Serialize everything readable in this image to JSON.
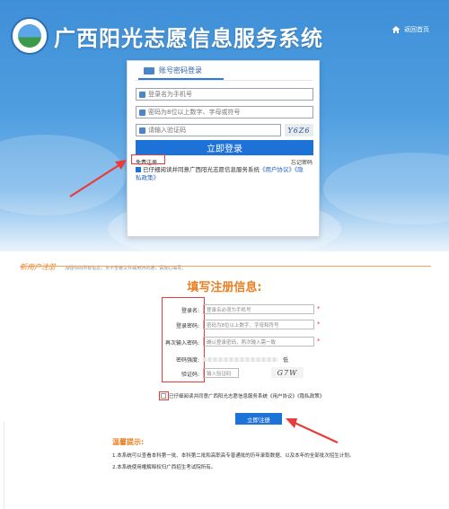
{
  "header": {
    "site_title": "广西阳光志愿信息服务系统",
    "home_link": "返回首页"
  },
  "login": {
    "tab_label": "账号密码登录",
    "username_placeholder": "登录名为手机号",
    "password_placeholder": "密码为8位以上数字、字母或符号",
    "captcha_placeholder": "请输入验证码",
    "captcha_text": "Y6Z6",
    "login_button": "立即登录",
    "register_link": "免费注册",
    "forgot_link": "忘记密码",
    "agree_text": "已仔细阅读并同意广西阳光志愿信息服务系统",
    "agree_link_user": "《用户协议》",
    "agree_and": "《隐",
    "agree_link_privacy": "私政策》"
  },
  "register": {
    "section_title": "新用户注册",
    "section_subtitle": "加强你的所有信息，务不全被文件或用外的通，请放心填写。",
    "form_title": "填写注册信息:",
    "rows": [
      {
        "label": "登录名:",
        "placeholder": "登录名必须为手机号"
      },
      {
        "label": "登录密码:",
        "placeholder": "密码为8位以上数字、字母和符号"
      },
      {
        "label": "再次输入密码:",
        "placeholder": "确认登录密码，两次输入需一致"
      },
      {
        "label": "密码强度:",
        "placeholder": ""
      },
      {
        "label": "验证码:",
        "placeholder": "输入验证码"
      }
    ],
    "strength_text": "低",
    "captcha_text": "G7W",
    "agree_text": "已仔细阅读并同意广西阳光志愿信息服务系统《用户协议》《隐私政策》",
    "submit_button": "立即注册"
  },
  "notice": {
    "title": "温馨提示:",
    "lines": [
      "1.本系统可以查看本科第一批、本科第二批和高职高专普通批的历年录取数据、以及本年的全部批次招生计划。",
      "2.本系统使用権解释权归广西招生考试院所有。"
    ]
  },
  "colors": {
    "accent": "#1d72d8",
    "highlight": "#e83c3c",
    "orange": "#e87f22"
  }
}
